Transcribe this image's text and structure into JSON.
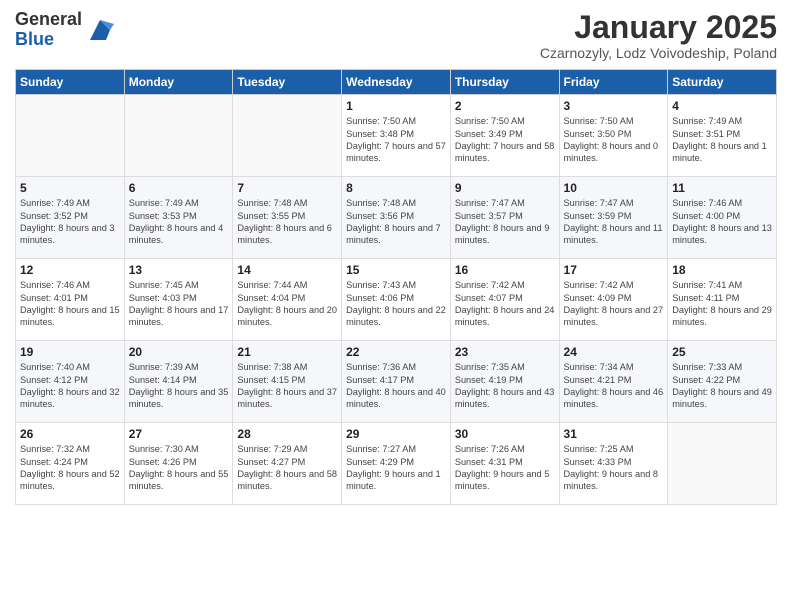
{
  "logo": {
    "general": "General",
    "blue": "Blue"
  },
  "title": "January 2025",
  "subtitle": "Czarnozyly, Lodz Voivodeship, Poland",
  "days": [
    "Sunday",
    "Monday",
    "Tuesday",
    "Wednesday",
    "Thursday",
    "Friday",
    "Saturday"
  ],
  "weeks": [
    [
      {
        "day": "",
        "content": ""
      },
      {
        "day": "",
        "content": ""
      },
      {
        "day": "",
        "content": ""
      },
      {
        "day": "1",
        "content": "Sunrise: 7:50 AM\nSunset: 3:48 PM\nDaylight: 7 hours and 57 minutes."
      },
      {
        "day": "2",
        "content": "Sunrise: 7:50 AM\nSunset: 3:49 PM\nDaylight: 7 hours and 58 minutes."
      },
      {
        "day": "3",
        "content": "Sunrise: 7:50 AM\nSunset: 3:50 PM\nDaylight: 8 hours and 0 minutes."
      },
      {
        "day": "4",
        "content": "Sunrise: 7:49 AM\nSunset: 3:51 PM\nDaylight: 8 hours and 1 minute."
      }
    ],
    [
      {
        "day": "5",
        "content": "Sunrise: 7:49 AM\nSunset: 3:52 PM\nDaylight: 8 hours and 3 minutes."
      },
      {
        "day": "6",
        "content": "Sunrise: 7:49 AM\nSunset: 3:53 PM\nDaylight: 8 hours and 4 minutes."
      },
      {
        "day": "7",
        "content": "Sunrise: 7:48 AM\nSunset: 3:55 PM\nDaylight: 8 hours and 6 minutes."
      },
      {
        "day": "8",
        "content": "Sunrise: 7:48 AM\nSunset: 3:56 PM\nDaylight: 8 hours and 7 minutes."
      },
      {
        "day": "9",
        "content": "Sunrise: 7:47 AM\nSunset: 3:57 PM\nDaylight: 8 hours and 9 minutes."
      },
      {
        "day": "10",
        "content": "Sunrise: 7:47 AM\nSunset: 3:59 PM\nDaylight: 8 hours and 11 minutes."
      },
      {
        "day": "11",
        "content": "Sunrise: 7:46 AM\nSunset: 4:00 PM\nDaylight: 8 hours and 13 minutes."
      }
    ],
    [
      {
        "day": "12",
        "content": "Sunrise: 7:46 AM\nSunset: 4:01 PM\nDaylight: 8 hours and 15 minutes."
      },
      {
        "day": "13",
        "content": "Sunrise: 7:45 AM\nSunset: 4:03 PM\nDaylight: 8 hours and 17 minutes."
      },
      {
        "day": "14",
        "content": "Sunrise: 7:44 AM\nSunset: 4:04 PM\nDaylight: 8 hours and 20 minutes."
      },
      {
        "day": "15",
        "content": "Sunrise: 7:43 AM\nSunset: 4:06 PM\nDaylight: 8 hours and 22 minutes."
      },
      {
        "day": "16",
        "content": "Sunrise: 7:42 AM\nSunset: 4:07 PM\nDaylight: 8 hours and 24 minutes."
      },
      {
        "day": "17",
        "content": "Sunrise: 7:42 AM\nSunset: 4:09 PM\nDaylight: 8 hours and 27 minutes."
      },
      {
        "day": "18",
        "content": "Sunrise: 7:41 AM\nSunset: 4:11 PM\nDaylight: 8 hours and 29 minutes."
      }
    ],
    [
      {
        "day": "19",
        "content": "Sunrise: 7:40 AM\nSunset: 4:12 PM\nDaylight: 8 hours and 32 minutes."
      },
      {
        "day": "20",
        "content": "Sunrise: 7:39 AM\nSunset: 4:14 PM\nDaylight: 8 hours and 35 minutes."
      },
      {
        "day": "21",
        "content": "Sunrise: 7:38 AM\nSunset: 4:15 PM\nDaylight: 8 hours and 37 minutes."
      },
      {
        "day": "22",
        "content": "Sunrise: 7:36 AM\nSunset: 4:17 PM\nDaylight: 8 hours and 40 minutes."
      },
      {
        "day": "23",
        "content": "Sunrise: 7:35 AM\nSunset: 4:19 PM\nDaylight: 8 hours and 43 minutes."
      },
      {
        "day": "24",
        "content": "Sunrise: 7:34 AM\nSunset: 4:21 PM\nDaylight: 8 hours and 46 minutes."
      },
      {
        "day": "25",
        "content": "Sunrise: 7:33 AM\nSunset: 4:22 PM\nDaylight: 8 hours and 49 minutes."
      }
    ],
    [
      {
        "day": "26",
        "content": "Sunrise: 7:32 AM\nSunset: 4:24 PM\nDaylight: 8 hours and 52 minutes."
      },
      {
        "day": "27",
        "content": "Sunrise: 7:30 AM\nSunset: 4:26 PM\nDaylight: 8 hours and 55 minutes."
      },
      {
        "day": "28",
        "content": "Sunrise: 7:29 AM\nSunset: 4:27 PM\nDaylight: 8 hours and 58 minutes."
      },
      {
        "day": "29",
        "content": "Sunrise: 7:27 AM\nSunset: 4:29 PM\nDaylight: 9 hours and 1 minute."
      },
      {
        "day": "30",
        "content": "Sunrise: 7:26 AM\nSunset: 4:31 PM\nDaylight: 9 hours and 5 minutes."
      },
      {
        "day": "31",
        "content": "Sunrise: 7:25 AM\nSunset: 4:33 PM\nDaylight: 9 hours and 8 minutes."
      },
      {
        "day": "",
        "content": ""
      }
    ]
  ]
}
